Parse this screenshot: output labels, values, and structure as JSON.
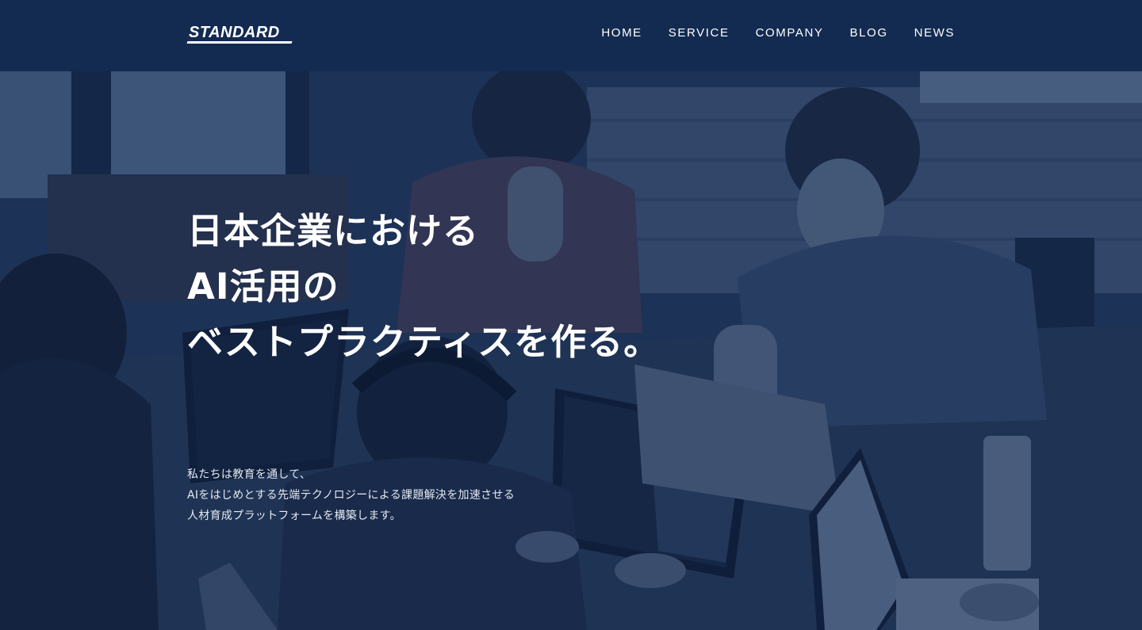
{
  "header": {
    "logo_text": "STANDARD",
    "nav": [
      "HOME",
      "SERVICE",
      "COMPANY",
      "BLOG",
      "NEWS"
    ]
  },
  "hero": {
    "headline": [
      "日本企業における",
      "AI活用の",
      "ベストプラクティスを作る。"
    ],
    "lead": [
      "私たちは教育を通して、",
      "AIをはじめとする先端テクノロジーによる課題解決を加速させる",
      "人材育成プラットフォームを構築します。"
    ]
  },
  "colors": {
    "header_bg": "#132b51",
    "overlay": "#10244a",
    "text": "#ffffff"
  }
}
